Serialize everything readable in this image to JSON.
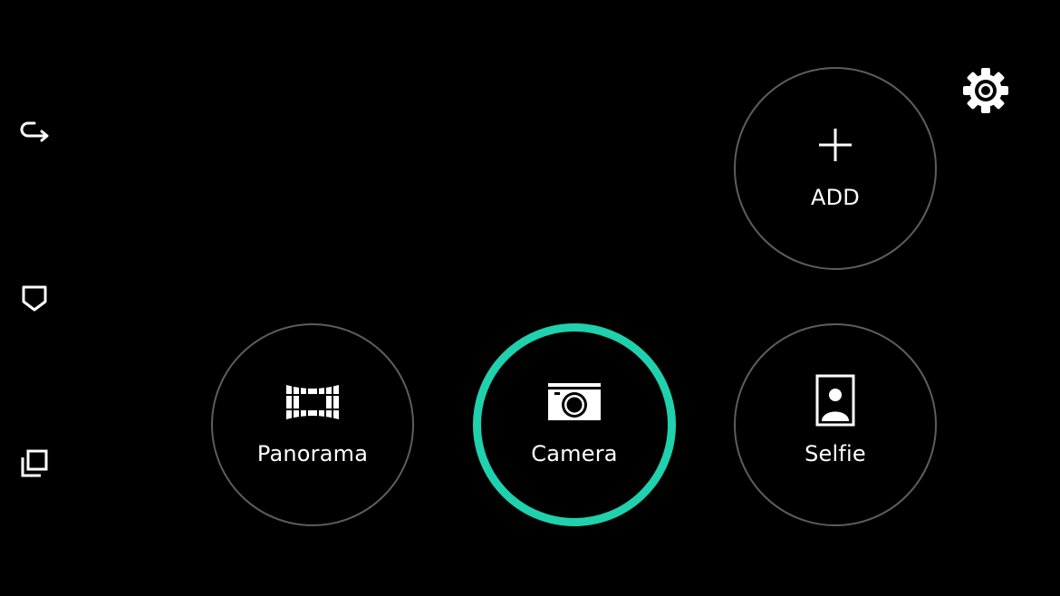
{
  "nav": {
    "back_icon": "back-arrow-icon",
    "home_icon": "home-icon",
    "recent_icon": "recent-apps-icon"
  },
  "settings": {
    "icon": "gear-icon"
  },
  "modes": {
    "add": {
      "label": "ADD",
      "icon": "plus-icon",
      "selected": false
    },
    "panorama": {
      "label": "Panorama",
      "icon": "panorama-icon",
      "selected": false
    },
    "camera": {
      "label": "Camera",
      "icon": "camera-icon",
      "selected": true
    },
    "selfie": {
      "label": "Selfie",
      "icon": "selfie-portrait-icon",
      "selected": false
    }
  },
  "colors": {
    "background": "#000000",
    "accent": "#1fd1ad",
    "circle_border": "#5d5d5d",
    "foreground": "#ffffff"
  }
}
